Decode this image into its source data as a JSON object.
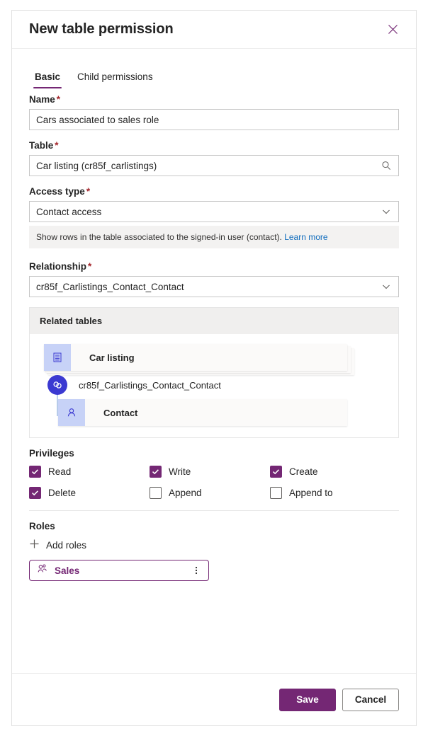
{
  "dialog": {
    "title": "New table permission",
    "close_icon": "close-icon"
  },
  "tabs": [
    {
      "label": "Basic",
      "active": true
    },
    {
      "label": "Child permissions",
      "active": false
    }
  ],
  "fields": {
    "name": {
      "label": "Name",
      "required": "*",
      "value": "Cars associated to sales role"
    },
    "table": {
      "label": "Table",
      "required": "*",
      "value": "Car listing (cr85f_carlistings)",
      "trailing_icon": "search-icon"
    },
    "access_type": {
      "label": "Access type",
      "required": "*",
      "value": "Contact access",
      "trailing_icon": "chevron-down-icon",
      "info_text": "Show rows in the table associated to the signed-in user (contact).",
      "info_link": "Learn more"
    },
    "relationship": {
      "label": "Relationship",
      "required": "*",
      "value": "cr85f_Carlistings_Contact_Contact",
      "trailing_icon": "chevron-down-icon"
    }
  },
  "related_tables": {
    "heading": "Related tables",
    "source_table": {
      "label": "Car listing",
      "icon": "table-icon"
    },
    "relationship_node": {
      "label": "cr85f_Carlistings_Contact_Contact",
      "icon": "link-icon"
    },
    "target_table": {
      "label": "Contact",
      "icon": "person-icon"
    }
  },
  "privileges": {
    "title": "Privileges",
    "items": [
      {
        "label": "Read",
        "checked": true
      },
      {
        "label": "Write",
        "checked": true
      },
      {
        "label": "Create",
        "checked": true
      },
      {
        "label": "Delete",
        "checked": true
      },
      {
        "label": "Append",
        "checked": false
      },
      {
        "label": "Append to",
        "checked": false
      }
    ]
  },
  "roles": {
    "title": "Roles",
    "add_label": "Add roles",
    "add_icon": "plus-icon",
    "items": [
      {
        "label": "Sales",
        "icon": "people-icon",
        "menu_icon": "more-vertical-icon"
      }
    ]
  },
  "footer": {
    "save_label": "Save",
    "cancel_label": "Cancel"
  },
  "colors": {
    "accent": "#742774",
    "required": "#a4262c",
    "link": "#0f6cbd",
    "node_blue": "#3b39d1",
    "node_tile": "#c7d2f7"
  }
}
